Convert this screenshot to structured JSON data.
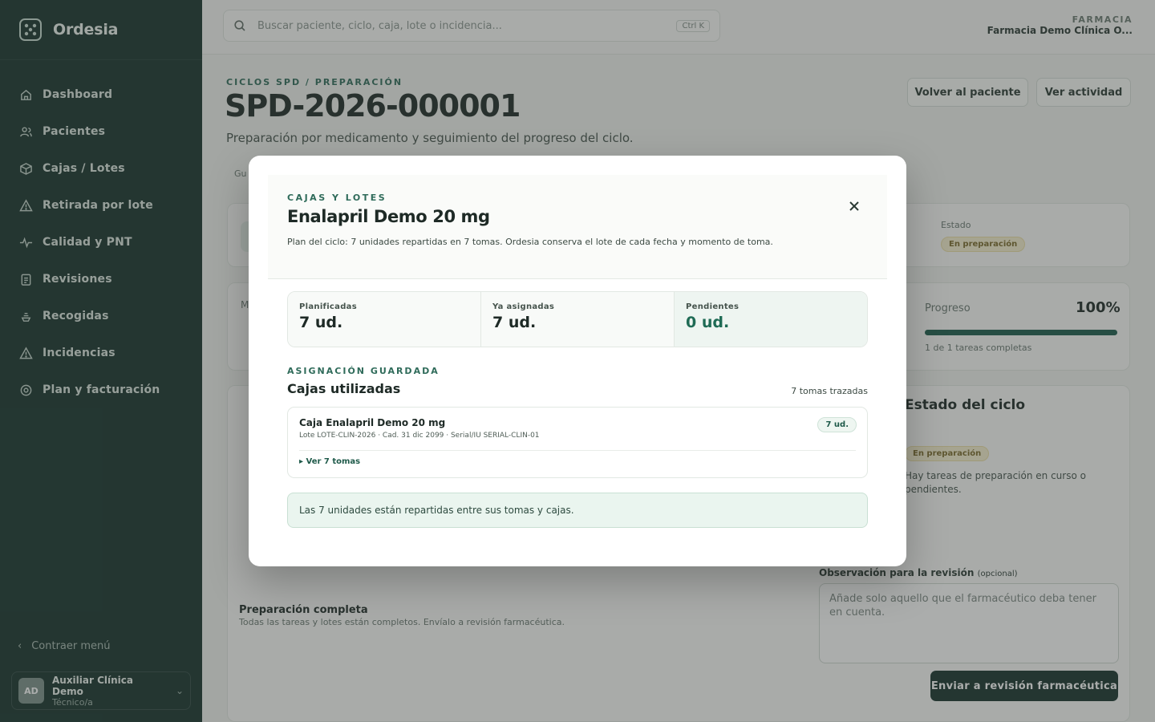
{
  "app": {
    "name": "Ordesia"
  },
  "sidebar": {
    "items": [
      {
        "label": "Dashboard",
        "icon": "home-icon"
      },
      {
        "label": "Pacientes",
        "icon": "users-icon"
      },
      {
        "label": "Cajas / Lotes",
        "icon": "box-icon"
      },
      {
        "label": "Retirada por lote",
        "icon": "warning-icon"
      },
      {
        "label": "Calidad y PNT",
        "icon": "pulse-icon"
      },
      {
        "label": "Revisiones",
        "icon": "clipboard-icon"
      },
      {
        "label": "Recogidas",
        "icon": "pickup-icon"
      },
      {
        "label": "Incidencias",
        "icon": "alert-icon"
      },
      {
        "label": "Plan y facturación",
        "icon": "settings-icon"
      }
    ],
    "collapse_label": "Contraer menú",
    "user": {
      "initials": "AD",
      "name": "Auxiliar Clínica Demo",
      "role": "Técnico/a"
    }
  },
  "topbar": {
    "search_placeholder": "Buscar paciente, ciclo, caja, lote o incidencia...",
    "shortcut": "Ctrl K",
    "pharmacy_label": "FARMACIA",
    "pharmacy_name": "Farmacia Demo Clínica O..."
  },
  "page": {
    "breadcrumb": "CICLOS SPD / PREPARACIÓN",
    "title": "SPD-2026-000001",
    "subtitle": "Preparación por medicamento y seguimiento del progreso del ciclo.",
    "back_button": "Volver al paciente",
    "activity_button": "Ver actividad",
    "tab_partial": "Gu",
    "status_label": "Estado",
    "status_value": "En preparación",
    "progress_label": "Progreso",
    "progress_value": "100%",
    "progress_fraction": 1.0,
    "progress_caption": "1 de 1 tareas completas",
    "cycle_state_title": "Estado del ciclo",
    "cycle_state_pill": "En preparación",
    "cycle_state_text": "Hay tareas de preparación en curso o pendientes.",
    "review_note_label": "Observación para la revisión",
    "review_note_optional": "(opcional)",
    "review_note_placeholder": "Añade solo aquello que el farmacéutico deba tener en cuenta.",
    "complete_title": "Preparación completa",
    "complete_text": "Todas las tareas y lotes están completos. Envíalo a revisión farmacéutica.",
    "send_button": "Enviar a revisión farmacéutica"
  },
  "modal": {
    "eyebrow": "CAJAS Y LOTES",
    "title": "Enalapril Demo 20 mg",
    "description": "Plan del ciclo: 7 unidades repartidas en 7 tomas. Ordesia conserva el lote de cada fecha y momento de toma.",
    "stats": [
      {
        "label": "Planificadas",
        "value": "7 ud."
      },
      {
        "label": "Ya asignadas",
        "value": "7 ud."
      },
      {
        "label": "Pendientes",
        "value": "0 ud."
      }
    ],
    "section_eyebrow": "ASIGNACIÓN GUARDADA",
    "section_title": "Cajas utilizadas",
    "section_count": "7 tomas trazadas",
    "box": {
      "name": "Caja Enalapril Demo 20 mg",
      "meta": "Lote LOTE-CLIN-2026 · Cad. 31 dic 2099 · Serial/IU SERIAL-CLIN-01",
      "badge": "7 ud.",
      "toggle": "▸ Ver 7 tomas"
    },
    "note": "Las 7 unidades están repartidas entre sus tomas y cajas."
  },
  "colors": {
    "sidebar": "#17332c",
    "accent": "#2f6b5a",
    "success_bg": "#eaf5ef"
  }
}
